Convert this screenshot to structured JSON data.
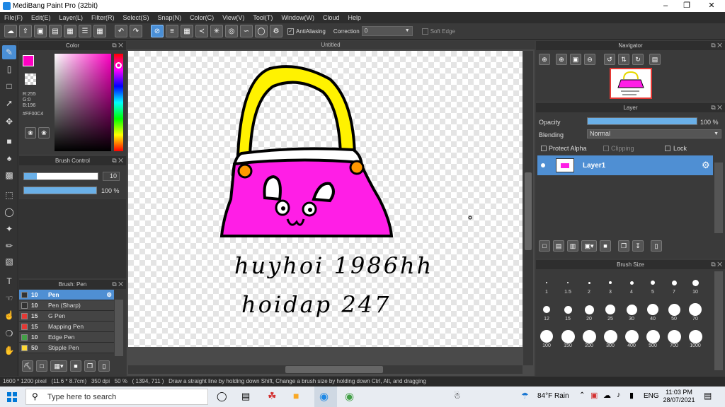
{
  "window": {
    "title": "MediBang Paint Pro (32bit)"
  },
  "menu": [
    "File(F)",
    "Edit(E)",
    "Layer(L)",
    "Filter(R)",
    "Select(S)",
    "Snap(N)",
    "Color(C)",
    "View(V)",
    "Tool(T)",
    "Window(W)",
    "Cloud",
    "Help"
  ],
  "toolbar": {
    "antialias_label": "AntiAliasing",
    "correction_label": "Correction",
    "correction_value": "0",
    "softedge_label": "Soft Edge"
  },
  "color_panel": {
    "title": "Color",
    "r": "R:255",
    "g": "G:0",
    "b": "B:196",
    "hex": "#FF00C4",
    "primary": "#ff00c4"
  },
  "brush_control": {
    "title": "Brush Control",
    "size": "10",
    "opacity": "100 %",
    "opacity_value": 1.0
  },
  "brush_panel": {
    "title": "Brush: Pen",
    "items": [
      {
        "size": "10",
        "name": "Pen",
        "color": "#333333"
      },
      {
        "size": "10",
        "name": "Pen (Sharp)",
        "color": "#333333"
      },
      {
        "size": "15",
        "name": "G Pen",
        "color": "#e53935"
      },
      {
        "size": "15",
        "name": "Mapping Pen",
        "color": "#e53935"
      },
      {
        "size": "10",
        "name": "Edge Pen",
        "color": "#43a047"
      },
      {
        "size": "50",
        "name": "Stipple Pen",
        "color": "#fdd835"
      }
    ]
  },
  "canvas": {
    "tab": "Untitled"
  },
  "drawing": {
    "line1": "huyhoi 1986hh",
    "line2": "hoidap 247"
  },
  "navigator": {
    "title": "Navigator"
  },
  "layer_panel": {
    "title": "Layer",
    "opacity_label": "Opacity",
    "opacity_value": "100 %",
    "blending_label": "Blending",
    "blending_value": "Normal",
    "protect_alpha": "Protect Alpha",
    "clipping": "Clipping",
    "lock": "Lock",
    "layer_name": "Layer1"
  },
  "brush_size_panel": {
    "title": "Brush Size",
    "sizes": [
      "1",
      "1.5",
      "2",
      "3",
      "4",
      "5",
      "7",
      "10",
      "12",
      "15",
      "20",
      "25",
      "30",
      "40",
      "50",
      "70",
      "100",
      "150",
      "200",
      "300",
      "400",
      "500",
      "700",
      "1000"
    ]
  },
  "status": {
    "text": "1600 * 1200 pixel   (11.6 * 8.7cm)   350 dpi   50 %   ( 1394, 711 )   Draw a straight line by holding down Shift, Change a brush size by holding down Ctrl, Alt, and dragging"
  },
  "taskbar": {
    "search": "Type here to search",
    "weather": "84°F  Rain",
    "lang": "ENG",
    "time": "11:03 PM",
    "date": "28/07/2021"
  }
}
